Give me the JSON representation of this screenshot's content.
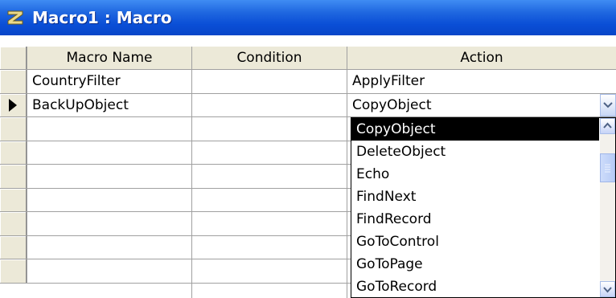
{
  "window": {
    "title": "Macro1 : Macro",
    "icon": "macro-icon"
  },
  "grid": {
    "columns": [
      "Macro Name",
      "Condition",
      "Action"
    ],
    "rows": [
      {
        "macro_name": "CountryFilter",
        "condition": "",
        "action": "ApplyFilter",
        "current": false
      },
      {
        "macro_name": "BackUpObject",
        "condition": "",
        "action": "CopyObject",
        "current": true
      },
      {
        "macro_name": "",
        "condition": "",
        "action": "",
        "current": false
      },
      {
        "macro_name": "",
        "condition": "",
        "action": "",
        "current": false
      },
      {
        "macro_name": "",
        "condition": "",
        "action": "",
        "current": false
      },
      {
        "macro_name": "",
        "condition": "",
        "action": "",
        "current": false
      },
      {
        "macro_name": "",
        "condition": "",
        "action": "",
        "current": false
      },
      {
        "macro_name": "",
        "condition": "",
        "action": "",
        "current": false
      },
      {
        "macro_name": "",
        "condition": "",
        "action": "",
        "current": false
      }
    ]
  },
  "dropdown": {
    "selected": "CopyObject",
    "items": [
      "CopyObject",
      "DeleteObject",
      "Echo",
      "FindNext",
      "FindRecord",
      "GoToControl",
      "GoToPage",
      "GoToRecord"
    ]
  }
}
